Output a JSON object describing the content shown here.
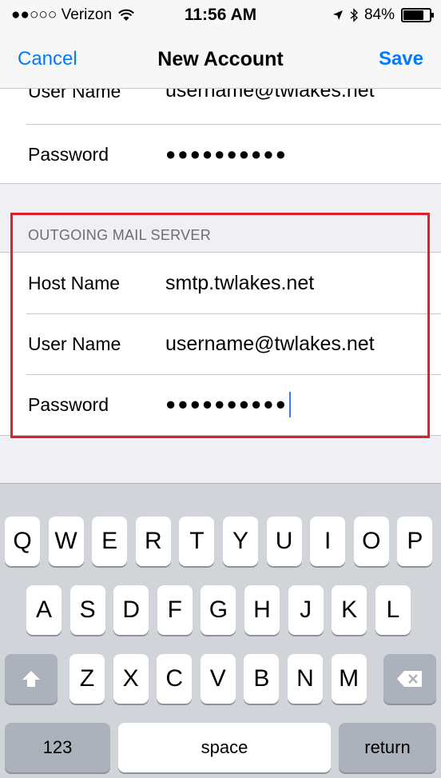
{
  "status_bar": {
    "carrier": "●●○○○ Verizon",
    "time": "11:56 AM",
    "battery": "84%",
    "battery_level": 0.84
  },
  "nav": {
    "cancel": "Cancel",
    "title": "New Account",
    "save": "Save",
    "accent_color": "#007aff"
  },
  "incoming": {
    "user_name_label": "User Name",
    "user_name_value": "username@twlakes.net",
    "password_label": "Password",
    "password_value": "●●●●●●●●●●"
  },
  "outgoing": {
    "header": "OUTGOING MAIL SERVER",
    "host_name_label": "Host Name",
    "host_name_value": "smtp.twlakes.net",
    "user_name_label": "User Name",
    "user_name_value": "username@twlakes.net",
    "password_label": "Password",
    "password_value": "●●●●●●●●●●",
    "highlight_color": "#e02028"
  },
  "keyboard": {
    "row1": [
      "Q",
      "W",
      "E",
      "R",
      "T",
      "Y",
      "U",
      "I",
      "O",
      "P"
    ],
    "row2": [
      "A",
      "S",
      "D",
      "F",
      "G",
      "H",
      "J",
      "K",
      "L"
    ],
    "row3": [
      "Z",
      "X",
      "C",
      "V",
      "B",
      "N",
      "M"
    ],
    "shift_icon": "shift-arrow-icon",
    "delete_icon": "backspace-icon",
    "numbers": "123",
    "space": "space",
    "return": "return"
  }
}
